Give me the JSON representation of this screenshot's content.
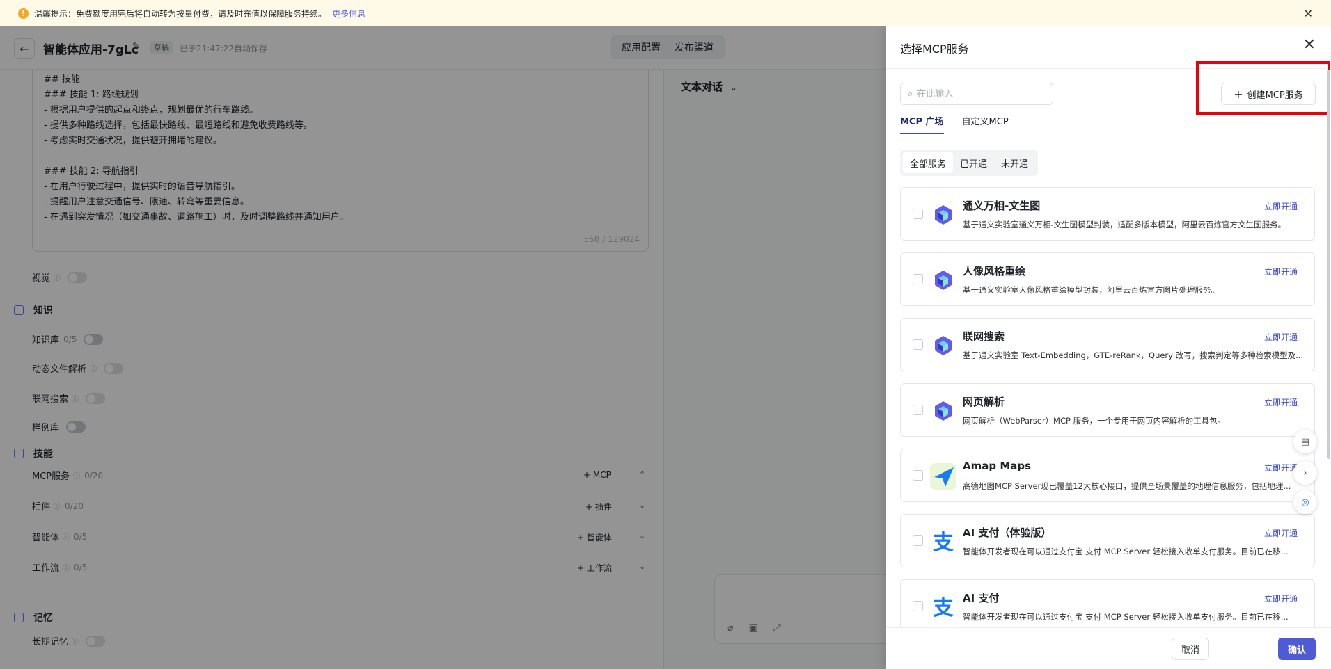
{
  "notice": {
    "text": "温馨提示：免费额度用完后将自动转为按量付费，请及时充值以保障服务持续。",
    "link": "更多信息"
  },
  "header": {
    "title": "智能体应用-7gLc",
    "badge": "草稿",
    "saved": "已于21:47:22自动保存",
    "tab_config": "应用配置",
    "tab_publish": "发布渠道"
  },
  "prompt": {
    "lines": [
      "## 技能",
      "### 技能 1: 路线规划",
      "- 根据用户提供的起点和终点，规划最优的行车路线。",
      "- 提供多种路线选择，包括最快路线、最短路线和避免收费路线等。",
      "- 考虑实时交通状况，提供避开拥堵的建议。",
      "",
      "### 技能 2: 导航指引",
      "- 在用户行驶过程中，提供实时的语音导航指引。",
      "- 提醒用户注意交通信号、限速、转弯等重要信息。",
      "- 在遇到突发情况（如交通事故、道路施工）时，及时调整路线并通知用户。"
    ],
    "counter": "558 / 129024"
  },
  "config": {
    "vision": "视觉",
    "knowledge_section": "知识",
    "kb_label": "知识库",
    "kb_count": "0/5",
    "dynamic_file": "动态文件解析",
    "web_search": "联网搜索",
    "sample_lib": "样例库",
    "skills_section": "技能",
    "mcp_label": "MCP服务",
    "mcp_count": "0/20",
    "mcp_add": "+ MCP",
    "plugin_label": "插件",
    "plugin_count": "0/20",
    "plugin_add": "+ 插件",
    "agent_label": "智能体",
    "agent_count": "0/5",
    "agent_add": "+ 智能体",
    "workflow_label": "工作流",
    "workflow_count": "0/5",
    "workflow_add": "+ 工作流",
    "memory_section": "记忆",
    "long_memory": "长期记忆"
  },
  "preview": {
    "mode": "文本对话"
  },
  "drawer": {
    "title": "选择MCP服务",
    "search_placeholder": "在此输入",
    "create_label": "创建MCP服务",
    "tabs": [
      "MCP 广场",
      "自定义MCP"
    ],
    "filters": [
      "全部服务",
      "已开通",
      "未开通"
    ],
    "open_action": "立即开通",
    "services": [
      {
        "name": "通义万相-文生图",
        "desc": "基于通义实验室通义万相-文生图模型封装，适配多版本模型，阿里云百炼官方文生图服务。",
        "logo": "bailian"
      },
      {
        "name": "人像风格重绘",
        "desc": "基于通义实验室人像风格重绘模型封装，阿里云百炼官方图片处理服务。",
        "logo": "bailian"
      },
      {
        "name": "联网搜索",
        "desc": "基于通义实验室 Text-Embedding，GTE-reRank，Query 改写，搜索判定等多种检索模型及...",
        "logo": "bailian"
      },
      {
        "name": "网页解析",
        "desc": "网页解析（WebParser）MCP 服务，一个专用于网页内容解析的工具包。",
        "logo": "bailian"
      },
      {
        "name": "Amap Maps",
        "desc": "高德地图MCP Server现已覆盖12大核心接口，提供全场景覆盖的地理信息服务，包括地理...",
        "logo": "amap"
      },
      {
        "name": "AI 支付（体验版）",
        "desc": "智能体开发者现在可以通过支付宝 支付 MCP Server 轻松接入收单支付服务。目前已在移...",
        "logo": "alipay"
      },
      {
        "name": "AI 支付",
        "desc": "智能体开发者现在可以通过支付宝 支付 MCP Server 轻松接入收单支付服务。目前已在移...",
        "logo": "alipay"
      }
    ],
    "cancel": "取消",
    "confirm": "确认"
  },
  "colors": {
    "accent": "#4f5bd5",
    "highlight": "#e8000b",
    "notice_bg": "#fff9e8"
  }
}
